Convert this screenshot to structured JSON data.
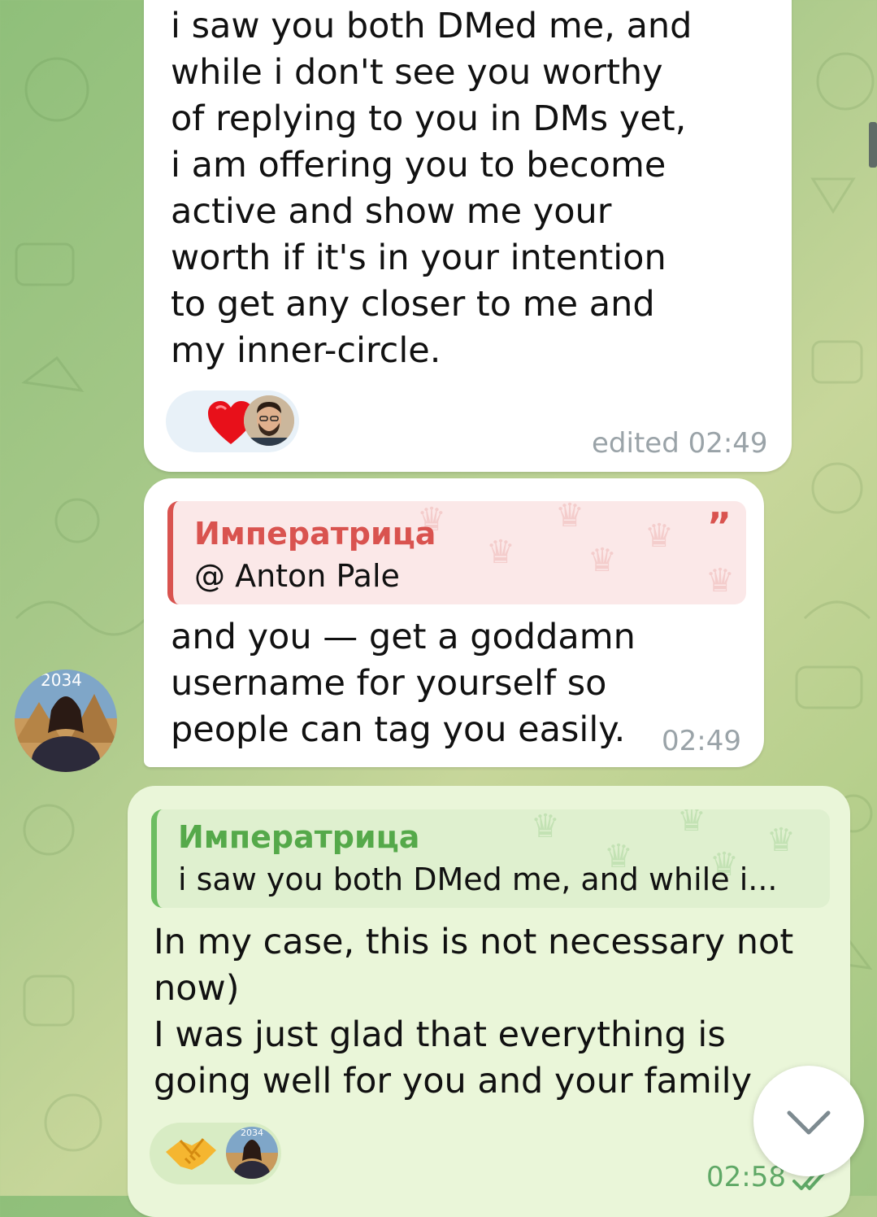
{
  "messages": [
    {
      "text": "i saw you both DMed me, and\nwhile i don't see you worthy\nof replying to you in DMs yet,\ni am offering you to become\nactive and show me your\nworth if it's in your intention\nto get any closer to me and\nmy inner-circle.",
      "time": "edited 02:49",
      "reactions": [
        "heart-emoji",
        "reactor-avatar-man"
      ]
    },
    {
      "quote": {
        "name": "Императрица",
        "text": "@ Anton Pale",
        "mark": "”"
      },
      "text": "and you — get a goddamn\nusername for yourself so\npeople can tag you easily.",
      "time": "02:49",
      "sender_avatar_text": "2034"
    },
    {
      "quote": {
        "name": "Императрица",
        "text": "i saw you both DMed me, and while i..."
      },
      "text": "In my case, this is not necessary not\nnow)\nI was just glad that everything is\ngoing well for you and your family",
      "time": "02:58",
      "status": "read-double-check",
      "reactions": [
        "handshake-emoji",
        "reactor-avatar-woman"
      ],
      "reactor_avatar_text": "2034"
    }
  ],
  "colors": {
    "incoming_bubble": "#ffffff",
    "outgoing_bubble": "#eaf6d9",
    "quote_accent_red": "#d9534f",
    "quote_accent_green": "#6cbd61",
    "time_gray": "#9aa3a8",
    "time_green": "#5fa866"
  }
}
